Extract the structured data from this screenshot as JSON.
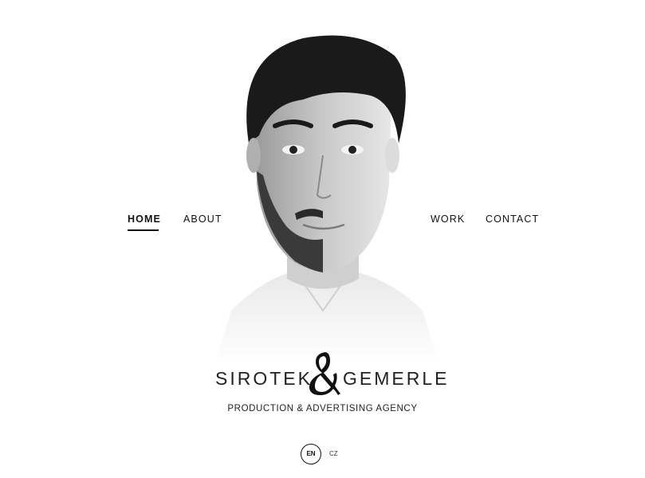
{
  "nav": {
    "home": "HOME",
    "about": "ABOUT",
    "work": "WORK",
    "contact": "CONTACT",
    "active": "home"
  },
  "brand": {
    "left_word": "SIROTEK",
    "ampersand": "&",
    "right_word": "GEMERLE",
    "tagline": "PRODUCTION & ADVERTISING AGENCY"
  },
  "language": {
    "options": [
      "EN",
      "CZ"
    ],
    "selected": "EN"
  },
  "icons": {
    "brand_mark": "ampersand-logo-icon",
    "hero": "portrait-photo"
  },
  "colors": {
    "background": "#ffffff",
    "text": "#111111"
  }
}
